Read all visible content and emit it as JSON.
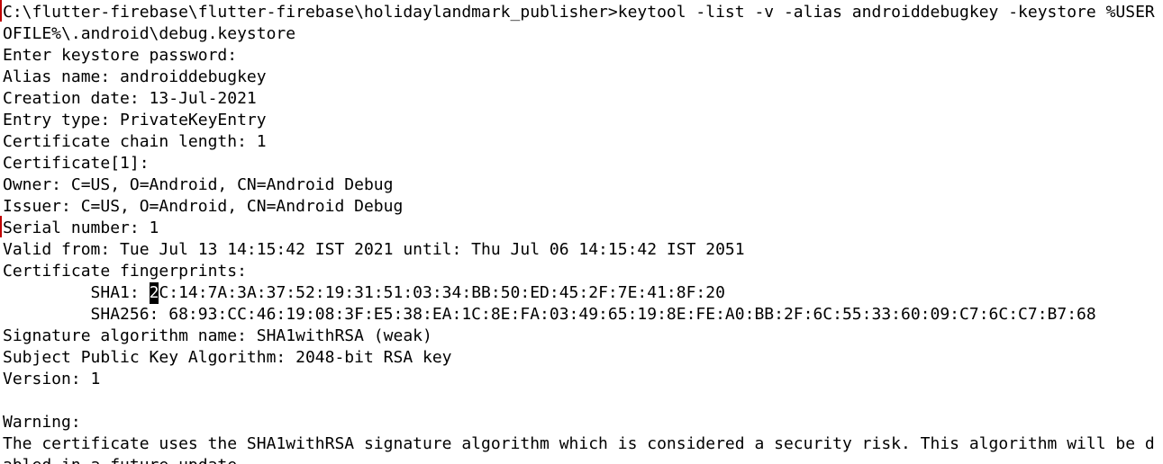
{
  "terminal": {
    "lines": [
      "C:\\flutter-firebase\\flutter-firebase\\holidaylandmark_publisher>keytool -list -v -alias androiddebugkey -keystore %USER",
      "OFILE%\\.android\\debug.keystore",
      "Enter keystore password:",
      "Alias name: androiddebugkey",
      "Creation date: 13-Jul-2021",
      "Entry type: PrivateKeyEntry",
      "Certificate chain length: 1",
      "Certificate[1]:",
      "Owner: C=US, O=Android, CN=Android Debug",
      "Issuer: C=US, O=Android, CN=Android Debug",
      "Serial number: 1",
      "Valid from: Tue Jul 13 14:15:42 IST 2021 until: Thu Jul 06 14:15:42 IST 2051",
      "Certificate fingerprints:",
      "",
      "         SHA256: 68:93:CC:46:19:08:3F:E5:38:EA:1C:8E:FA:03:49:65:19:8E:FE:A0:BB:2F:6C:55:33:60:09:C7:6C:C7:B7:68",
      "Signature algorithm name: SHA1withRSA (weak)",
      "Subject Public Key Algorithm: 2048-bit RSA key",
      "Version: 1",
      "",
      "Warning:",
      "The certificate uses the SHA1withRSA signature algorithm which is considered a security risk. This algorithm will be d",
      "abled in a future update."
    ],
    "sha1": {
      "prefix": "         SHA1: ",
      "cursor_char": "2",
      "rest": "C:14:7A:3A:37:52:19:31:51:03:34:BB:50:ED:45:2F:7E:41:8F:20"
    }
  }
}
